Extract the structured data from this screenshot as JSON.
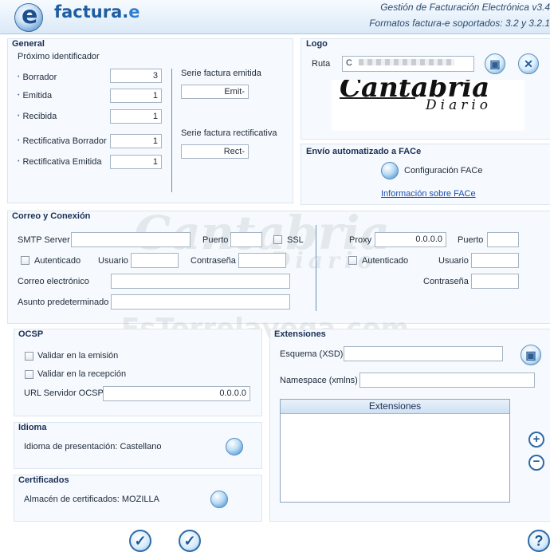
{
  "header": {
    "brand_prefix": "factura.",
    "brand_suffix": "e",
    "line1": "Gestión de Facturación Electrónica v3.4",
    "line2": "Formatos factura-e soportados: 3.2 y 3.2.1"
  },
  "general": {
    "title": "General",
    "subtitle": "Próximo identificador",
    "rows": [
      {
        "label": "Borrador",
        "value": "3"
      },
      {
        "label": "Emitida",
        "value": "1"
      },
      {
        "label": "Recibida",
        "value": "1"
      },
      {
        "label": "Rectificativa Borrador",
        "value": "1"
      },
      {
        "label": "Rectificativa Emitida",
        "value": "1"
      }
    ],
    "serie_emitida_label": "Serie factura emitida",
    "serie_emitida_value": "Emit-",
    "serie_rect_label": "Serie factura rectificativa",
    "serie_rect_value": "Rect-"
  },
  "logo": {
    "title": "Logo",
    "ruta_label": "Ruta",
    "ruta_value": "C",
    "image_text_1": "Cantabria",
    "image_text_2": "Diario"
  },
  "face": {
    "title": "Envío automatizado a FACe",
    "config_label": "Configuración FACe",
    "info_link": "Información sobre FACe"
  },
  "correo": {
    "title": "Correo y Conexión",
    "smtp_label": "SMTP Server",
    "smtp_value": "",
    "puerto_label": "Puerto",
    "puerto_value": "",
    "ssl_label": "SSL",
    "autenticado_label": "Autenticado",
    "usuario_label": "Usuario",
    "contrasena_label": "Contraseña",
    "correo_label": "Correo electrónico",
    "asunto_label": "Asunto predeterminado",
    "proxy_label": "Proxy",
    "proxy_value": "0.0.0.0",
    "proxy_puerto_label": "Puerto",
    "proxy_autenticado_label": "Autenticado",
    "proxy_usuario_label": "Usuario",
    "proxy_contrasena_label": "Contraseña"
  },
  "ocsp": {
    "title": "OCSP",
    "validar_emision": "Validar en la emisión",
    "validar_recepcion": "Validar en la recepción",
    "url_label": "URL Servidor OCSP",
    "url_value": "0.0.0.0"
  },
  "idioma": {
    "title": "Idioma",
    "label": "Idioma de presentación: Castellano"
  },
  "certificados": {
    "title": "Certificados",
    "label": "Almacén de certificados: MOZILLA"
  },
  "extensiones": {
    "title": "Extensiones",
    "esquema_label": "Esquema (XSD)",
    "namespace_label": "Namespace (xmlns)",
    "list_header": "Extensiones"
  },
  "watermark": {
    "line1": "Cantabria",
    "line2": "Diario",
    "line3": "EsTorrelavega.com"
  }
}
